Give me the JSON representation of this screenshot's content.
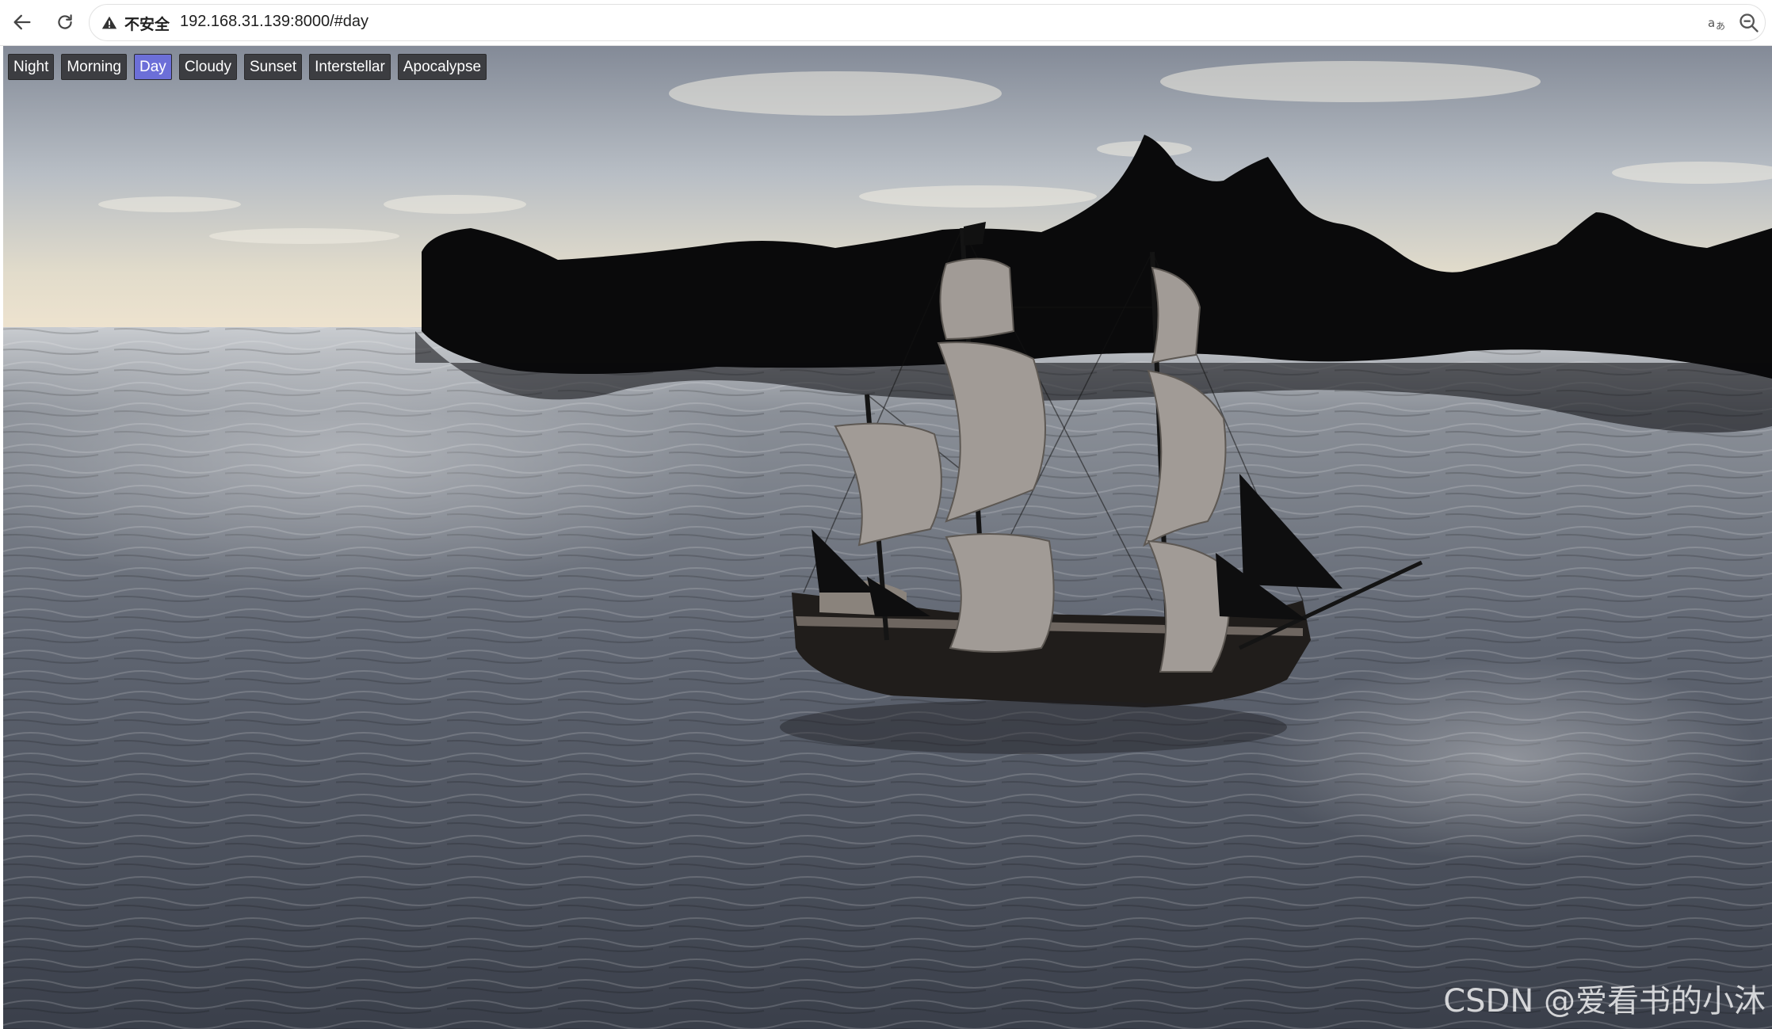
{
  "browser": {
    "security_label": "不安全",
    "url": "192.168.31.139:8000/#day",
    "icons": [
      "back-arrow-icon",
      "reload-icon",
      "warning-icon",
      "translate-icon",
      "zoom-icon"
    ]
  },
  "presets": [
    {
      "label": "Night",
      "active": false
    },
    {
      "label": "Morning",
      "active": false
    },
    {
      "label": "Day",
      "active": true
    },
    {
      "label": "Cloudy",
      "active": false
    },
    {
      "label": "Sunset",
      "active": false
    },
    {
      "label": "Interstellar",
      "active": false
    },
    {
      "label": "Apocalypse",
      "active": false
    }
  ],
  "colors": {
    "preset_bg": "#3c3d41",
    "preset_active_bg": "#6c6fd8"
  },
  "watermark": "CSDN @爱看书的小沐"
}
